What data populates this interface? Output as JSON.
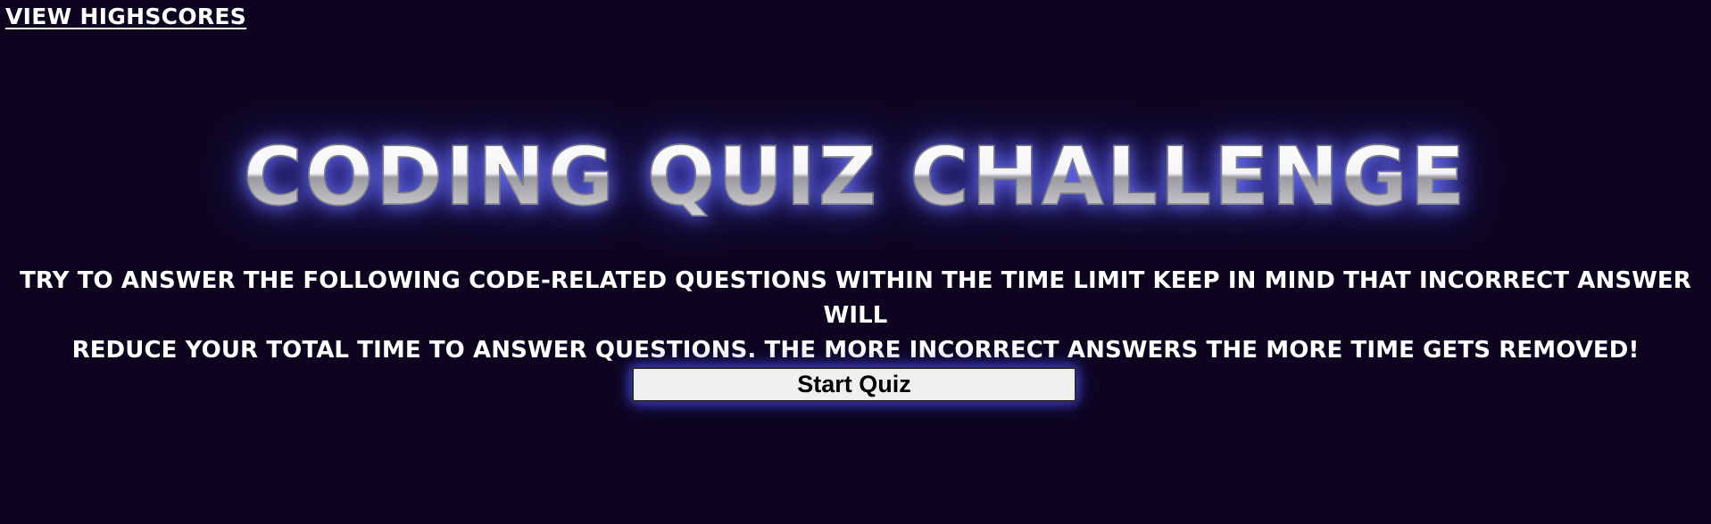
{
  "header": {
    "highscores_link": "VIEW HIGHSCORES"
  },
  "main": {
    "title": "CODING QUIZ CHALLENGE",
    "instructions_line1": "TRY TO ANSWER THE FOLLOWING CODE-RELATED QUESTIONS WITHIN THE TIME LIMIT KEEP IN MIND THAT INCORRECT ANSWER WILL",
    "instructions_line2": "REDUCE YOUR TOTAL TIME TO ANSWER QUESTIONS. THE MORE INCORRECT ANSWERS THE MORE TIME GETS REMOVED!",
    "start_button_label": "Start Quiz"
  },
  "colors": {
    "background": "#0d0520",
    "text": "#ffffff",
    "glow": "#5a5af0",
    "button_background": "#efefef"
  }
}
